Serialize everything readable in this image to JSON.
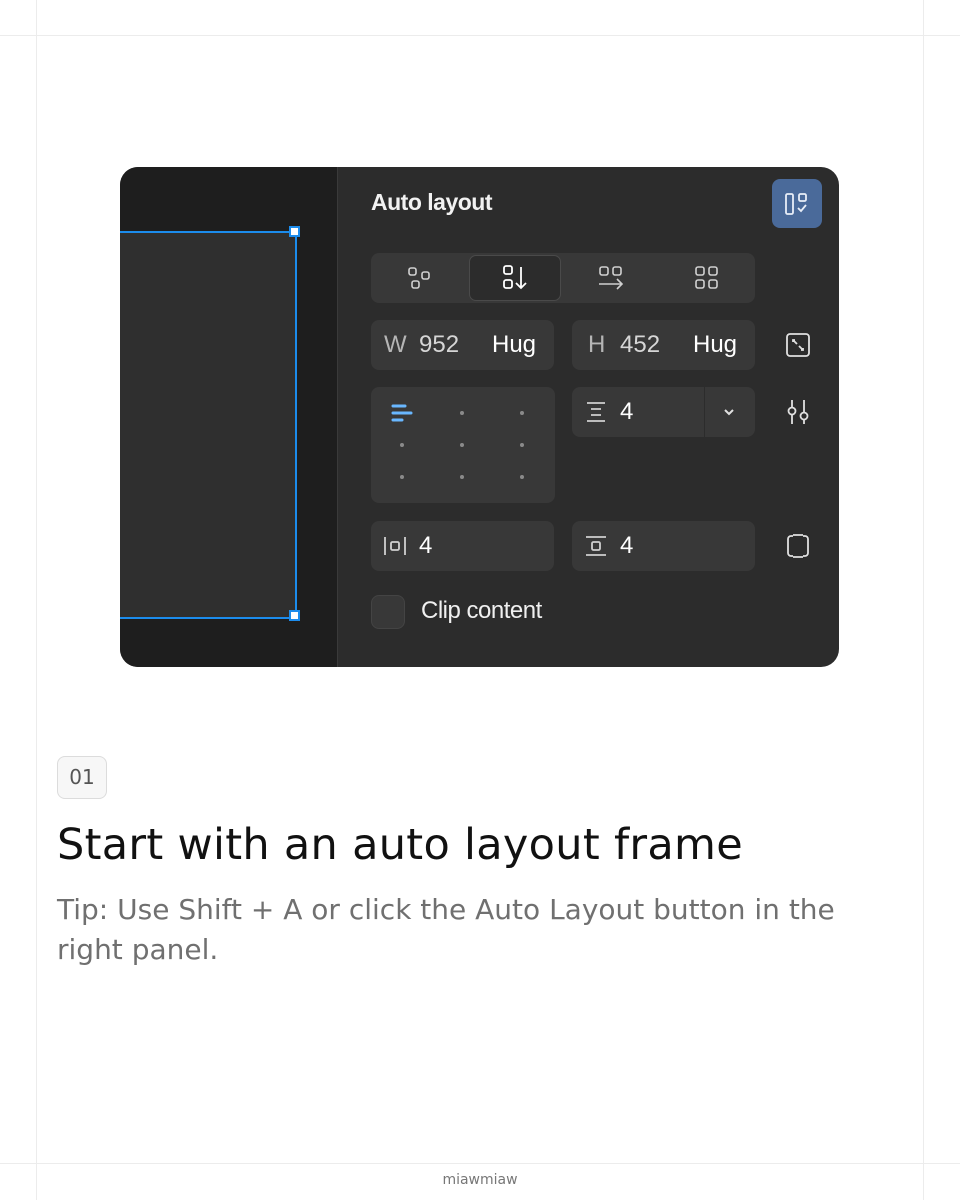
{
  "panel": {
    "title": "Auto layout",
    "direction_options": [
      {
        "name": "wrap-free",
        "active": false
      },
      {
        "name": "vertical",
        "active": true
      },
      {
        "name": "horizontal",
        "active": false
      },
      {
        "name": "grid",
        "active": false
      }
    ],
    "width": {
      "label": "W",
      "value": "952",
      "mode": "Hug"
    },
    "height": {
      "label": "H",
      "value": "452",
      "mode": "Hug"
    },
    "gap": {
      "value": "4"
    },
    "padding_horizontal": {
      "value": "4"
    },
    "padding_vertical": {
      "value": "4"
    },
    "clip_content": {
      "label": "Clip content",
      "checked": false
    },
    "colors": {
      "selection": "#1c8cec",
      "accent_button": "#4a6a9a",
      "align_active": "#69b7ff"
    }
  },
  "step": {
    "number": "01",
    "title": "Start with an auto layout frame",
    "tip": "Tip: Use Shift + A or click the Auto Layout button in the right panel."
  },
  "footer": {
    "credit": "miawmiaw"
  }
}
